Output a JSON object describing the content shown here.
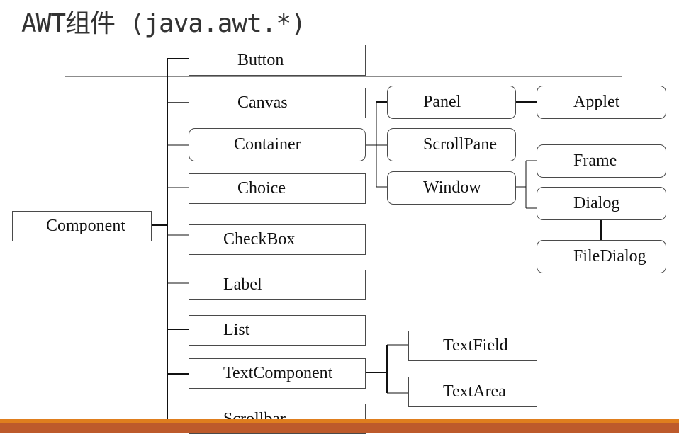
{
  "title": "AWT组件 (java.awt.*)",
  "root": "Component",
  "children": [
    "Button",
    "Canvas",
    "Container",
    "Choice",
    "CheckBox",
    "Label",
    "List",
    "TextComponent",
    "Scrollbar"
  ],
  "container_children": [
    "Panel",
    "ScrollPane",
    "Window"
  ],
  "panel_children": [
    "Applet"
  ],
  "window_children": [
    "Frame",
    "Dialog"
  ],
  "dialog_children": [
    "FileDialog"
  ],
  "textcomponent_children": [
    "TextField",
    "TextArea"
  ],
  "colors": {
    "footer_top": "#df7e1e",
    "footer_bottom": "#bd5a2b",
    "line": "#111111"
  }
}
